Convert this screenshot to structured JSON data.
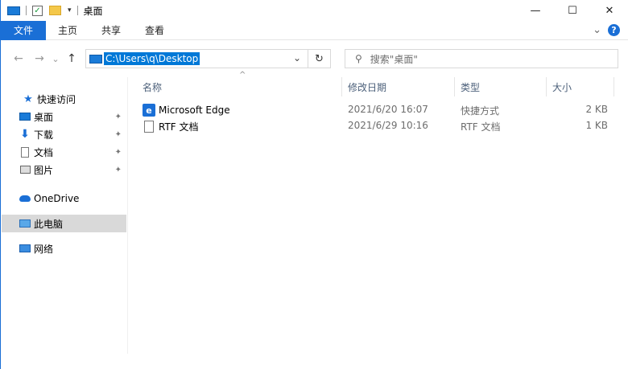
{
  "window": {
    "title": "桌面",
    "minimize_glyph": "—",
    "maximize_glyph": "☐",
    "close_glyph": "✕"
  },
  "ribbon": {
    "tabs": [
      {
        "label": "文件"
      },
      {
        "label": "主页"
      },
      {
        "label": "共享"
      },
      {
        "label": "查看"
      }
    ],
    "expand_glyph": "⌄",
    "help_glyph": "?"
  },
  "nav": {
    "back_glyph": "←",
    "forward_glyph": "→",
    "recent_glyph": "⌄",
    "up_glyph": "↑",
    "address_path": "C:\\Users\\q\\Desktop",
    "address_drop_glyph": "⌄",
    "refresh_glyph": "↻",
    "search_glyph": "⚲",
    "search_placeholder": "搜索\"桌面\""
  },
  "sidebar": {
    "items": [
      {
        "label": "快速访问",
        "icon": "star-icon"
      },
      {
        "label": "桌面",
        "icon": "desktop-icon",
        "pinned": true
      },
      {
        "label": "下载",
        "icon": "download-icon",
        "pinned": true
      },
      {
        "label": "文档",
        "icon": "document-icon",
        "pinned": true
      },
      {
        "label": "图片",
        "icon": "pictures-icon",
        "pinned": true
      },
      {
        "label": "OneDrive",
        "icon": "cloud-icon"
      },
      {
        "label": "此电脑",
        "icon": "computer-icon",
        "selected": true
      },
      {
        "label": "网络",
        "icon": "network-icon"
      }
    ],
    "pin_glyph": "📌"
  },
  "list": {
    "sort_glyph": "^",
    "columns": [
      "名称",
      "修改日期",
      "类型",
      "大小"
    ],
    "rows": [
      {
        "name": "Microsoft Edge",
        "icon": "edge-shortcut-icon",
        "modified": "2021/6/20 16:07",
        "type": "快捷方式",
        "size": "2 KB"
      },
      {
        "name": "RTF 文档",
        "icon": "rtf-document-icon",
        "modified": "2021/6/29 10:16",
        "type": "RTF 文档",
        "size": "1 KB"
      }
    ]
  },
  "colors": {
    "accent": "#1a6fd6",
    "selection": "#0078d7",
    "sidebar_selected": "#d9d9d9",
    "header_text": "#4c607a",
    "meta_text": "#6d6d6d"
  }
}
